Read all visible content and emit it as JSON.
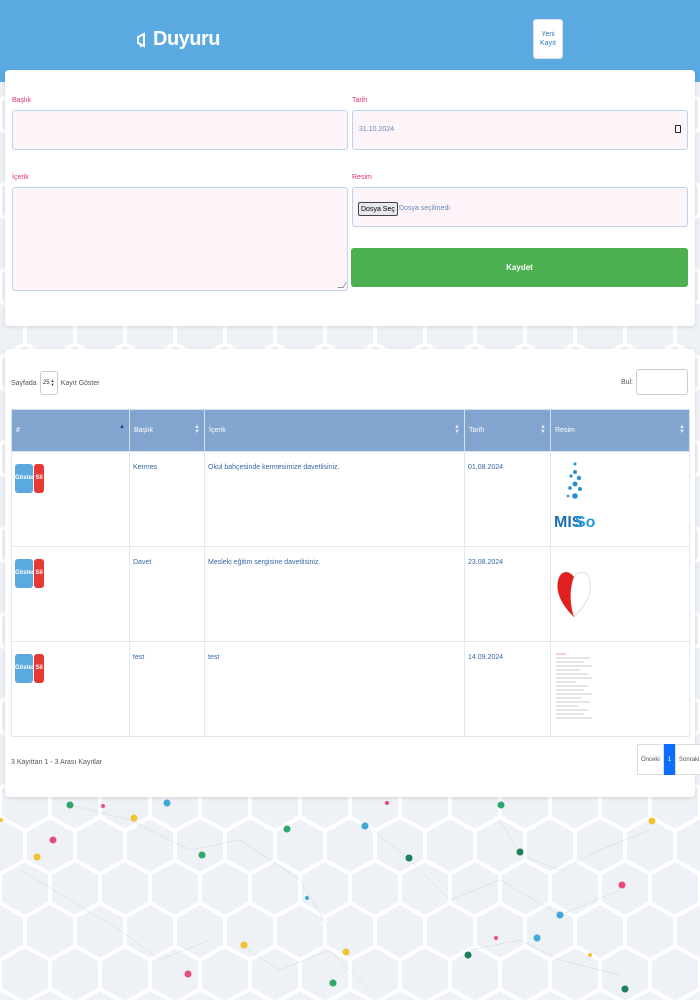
{
  "header": {
    "brand": "Duyuru",
    "new_record_label": "Yeni Kayıt"
  },
  "form": {
    "title_label": "Başlık",
    "title_value": "",
    "date_label": "Tarih",
    "date_value": "31.10.2024",
    "content_label": "İçerik",
    "content_value": "",
    "image_label": "Resim",
    "file_button": "Dosya Seç",
    "file_status": "Dosya seçilmedi",
    "save_label": "Kaydet"
  },
  "table": {
    "length_prefix": "Sayfada",
    "length_value": "25",
    "length_suffix": "Kayıt Göster",
    "search_label": "Bul:",
    "columns": [
      "#",
      "Başlık",
      "İçerik",
      "Tarih",
      "Resim"
    ],
    "show_label": "Göster",
    "delete_label": "Sil",
    "rows": [
      {
        "title": "Kermes",
        "content": "Okul bahçesinde kermesimize davetlisiniz.",
        "date": "01.08.2024",
        "image": "missoft-logo"
      },
      {
        "title": "Davet",
        "content": "Mesleki eğitim sergisine davetlisiniz.",
        "date": "23.08.2024",
        "image": "heart-image"
      },
      {
        "title": "test",
        "content": "test",
        "date": "14.09.2024",
        "image": "document-thumbnail"
      }
    ],
    "info": "3 Kayıttan 1 - 3 Arası Kayıtlar",
    "pager": {
      "prev": "Önceki",
      "current": "1",
      "next": "Sonraki"
    }
  },
  "logo_text": {
    "mis": "MIS",
    "soft": "Soft"
  },
  "colors": {
    "header": "#5aa9e0",
    "save": "#4caf50",
    "show": "#5aa9e0",
    "delete": "#e53935",
    "table_header": "#82a5cf",
    "label": "#e0357a"
  }
}
